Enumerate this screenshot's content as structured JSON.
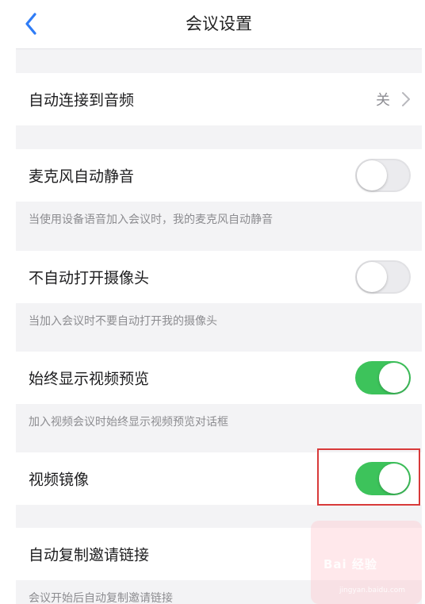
{
  "header": {
    "title": "会议设置"
  },
  "rows": [
    {
      "label": "自动连接到音频",
      "value": "关"
    },
    {
      "label": "麦克风自动静音",
      "enabled": false,
      "description": "当使用设备语音加入会议时，我的麦克风自动静音"
    },
    {
      "label": "不自动打开摄像头",
      "enabled": false,
      "description": "当加入会议时不要自动打开我的摄像头"
    },
    {
      "label": "始终显示视频预览",
      "enabled": true,
      "description": "加入视频会议时始终显示视频预览对话框"
    },
    {
      "label": "视频镜像",
      "enabled": true
    },
    {
      "label": "自动复制邀请链接",
      "description": "会议开始后自动复制邀请链接"
    }
  ],
  "watermark": {
    "brand": "Bai 经验",
    "sub": "jingyan.baidu.com"
  },
  "colors": {
    "accent": "#2f7cf6",
    "toggle_on": "#3dc35b",
    "highlight": "#d83a3a"
  }
}
